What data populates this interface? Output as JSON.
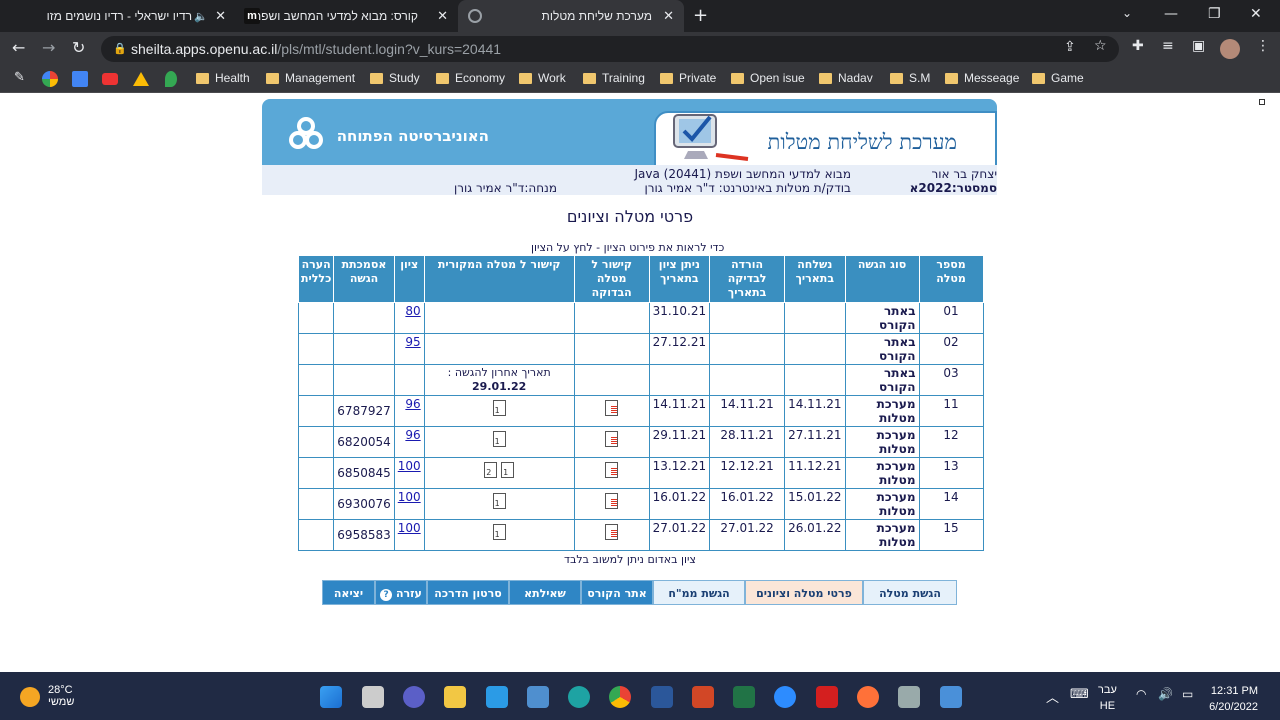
{
  "browser": {
    "tabs": [
      {
        "title": "רדיו ישראלי - רדיו נושמים מזו"
      },
      {
        "title": "קורס: מבוא למדעי המחשב ושפת"
      },
      {
        "title": "מערכת שליחת מטלות"
      }
    ],
    "url_host": "sheilta.apps.openu.ac.il",
    "url_path": "/pls/mtl/student.login?v_kurs=20441",
    "bookmarks": [
      "Health",
      "Management",
      "Study",
      "Economy",
      "Work",
      "Training",
      "Private",
      "Open isue",
      "Nadav",
      "S.M",
      "Messeage",
      "Game"
    ]
  },
  "banner": {
    "system_title": "מערכת לשליחת מטלות",
    "university": "האוניברסיטה הפתוחה"
  },
  "info": {
    "student": "יצחק בר אור",
    "semester": "סמסטר:2022א",
    "course": "מבוא למדעי המחשב ושפת (20441) Java",
    "checker": "בודק/ת מטלות באינטרנט:  ד\"ר אמיר גורן",
    "tutor": "מנחה:ד\"ר אמיר גורן"
  },
  "heading": "פרטי מטלה וציונים",
  "hint": "כדי לראות את פירוט הציון - לחץ על הציון",
  "table": {
    "headers": [
      "מספר מטלה",
      "סוג הגשה",
      "נשלחה בתאריך",
      "הורדה לבדיקה בתאריך",
      "ניתן ציון בתאריך",
      "קישור ל מטלה הבדוקה",
      "קישור ל מטלה המקורית",
      "ציון",
      "אסמכתת הגשה",
      "הערה כללית"
    ],
    "rows": [
      {
        "num": "01",
        "type": "באתר הקורס",
        "sent": "",
        "down": "",
        "graded": "31.10.21",
        "checked": "",
        "orig": "",
        "grade": "80",
        "ref": "",
        "note": ""
      },
      {
        "num": "02",
        "type": "באתר הקורס",
        "sent": "",
        "down": "",
        "graded": "27.12.21",
        "checked": "",
        "orig": "",
        "grade": "95",
        "ref": "",
        "note": ""
      },
      {
        "num": "03",
        "type": "באתר הקורס",
        "sent": "",
        "down": "",
        "graded": "",
        "checked": "",
        "orig": "תאריך אחרון להגשה :",
        "orig2": "29.01.22",
        "grade": "",
        "ref": "",
        "note": ""
      },
      {
        "num": "11",
        "type": "מערכת מטלות",
        "sent": "14.11.21",
        "down": "14.11.21",
        "graded": "14.11.21",
        "grade": "96",
        "ref": "6787927",
        "note": ""
      },
      {
        "num": "12",
        "type": "מערכת מטלות",
        "sent": "27.11.21",
        "down": "28.11.21",
        "graded": "29.11.21",
        "grade": "96",
        "ref": "6820054",
        "note": ""
      },
      {
        "num": "13",
        "type": "מערכת מטלות",
        "sent": "11.12.21",
        "down": "12.12.21",
        "graded": "13.12.21",
        "grade": "100",
        "ref": "6850845",
        "note": ""
      },
      {
        "num": "14",
        "type": "מערכת מטלות",
        "sent": "15.01.22",
        "down": "16.01.22",
        "graded": "16.01.22",
        "grade": "100",
        "ref": "6930076",
        "note": ""
      },
      {
        "num": "15",
        "type": "מערכת מטלות",
        "sent": "26.01.22",
        "down": "27.01.22",
        "graded": "27.01.22",
        "grade": "100",
        "ref": "6958583",
        "note": ""
      }
    ]
  },
  "note": "ציון באדום ניתן למשוב בלבד",
  "nav": [
    "הגשת מטלה",
    "פרטי מטלה וציונים",
    "הגשת ממ\"ח",
    "אתר הקורס",
    "שאילתא",
    "סרטון הדרכה",
    "עזרה",
    "יציאה"
  ],
  "taskbar": {
    "temp": "28°C",
    "weather": "שמשי",
    "lang_top": "עבר",
    "lang_bottom": "HE",
    "time": "12:31 PM",
    "date": "6/20/2022"
  }
}
